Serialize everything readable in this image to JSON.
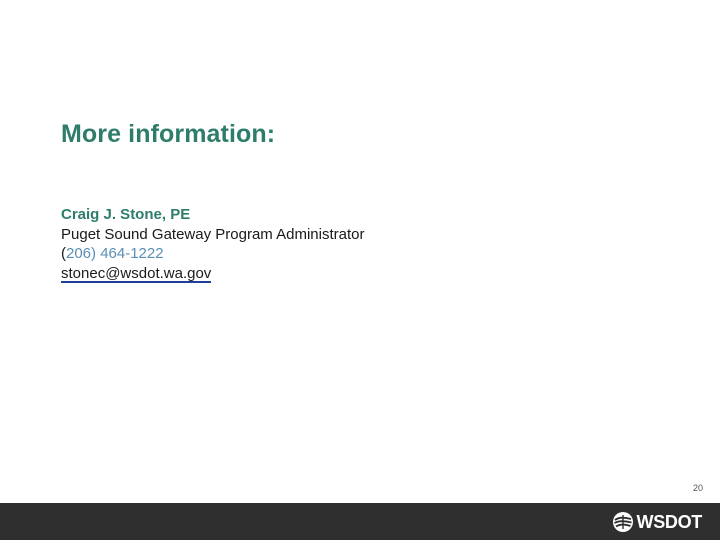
{
  "slide": {
    "heading": "More information:",
    "contact": {
      "name": "Craig J. Stone, PE",
      "title": "Puget Sound Gateway Program Administrator",
      "phone_open": "(",
      "phone_rest": "206) 464-1222",
      "email": "stonec@wsdot.wa.gov"
    },
    "page_number": "20"
  },
  "footer": {
    "logo_text": "WSDOT",
    "logo_icon": "wsdot-swoosh-icon"
  },
  "colors": {
    "heading": "#2e7d6b",
    "phone_digits": "#5a8fb5",
    "email_underline": "#1f3f9c",
    "footer_bar": "#2f2f2f"
  }
}
